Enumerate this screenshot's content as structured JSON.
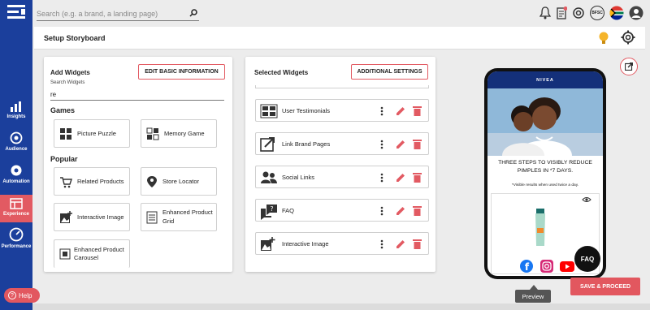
{
  "sidebar": {
    "items": [
      {
        "label": "Insights",
        "icon": "bar-chart-icon"
      },
      {
        "label": "Audience",
        "icon": "target-icon"
      },
      {
        "label": "Automation",
        "icon": "gear-icon"
      },
      {
        "label": "Experience",
        "icon": "layout-icon"
      },
      {
        "label": "Performance",
        "icon": "gauge-icon"
      }
    ],
    "help_label": "Help"
  },
  "topbar": {
    "search_placeholder": "Search (e.g. a brand, a landing page)",
    "badge_text": "BFSC"
  },
  "header": {
    "title": "Setup Storyboard"
  },
  "add_widgets": {
    "title": "Add Widgets",
    "edit_button": "EDIT BASIC INFORMATION",
    "search_label": "Search Widgets",
    "search_value": "re",
    "sections": [
      {
        "title": "Games",
        "items": [
          "Picture Puzzle",
          "Memory Game"
        ]
      },
      {
        "title": "Popular",
        "items": [
          "Related Products",
          "Store Locator",
          "Interactive Image",
          "Enhanced Product Grid",
          "Enhanced Product Carousel"
        ]
      }
    ]
  },
  "selected_widgets": {
    "title": "Selected Widgets",
    "settings_button": "ADDITIONAL SETTINGS",
    "items": [
      "User Testimonials",
      "Link Brand Pages",
      "Social Links",
      "FAQ",
      "Interactive Image"
    ]
  },
  "preview": {
    "brand": "NIVEA",
    "headline": "THREE STEPS TO VISIBLY REDUCE PIMPLES IN *7 DAYS.",
    "note": "*Visible results when used twice a day.",
    "faq_label": "FAQ",
    "tooltip": "Preview"
  },
  "actions": {
    "save_label": "SAVE & PROCEED"
  },
  "colors": {
    "sidebar": "#1b3f9c",
    "accent": "#e25a62",
    "active": "#e25a62"
  }
}
